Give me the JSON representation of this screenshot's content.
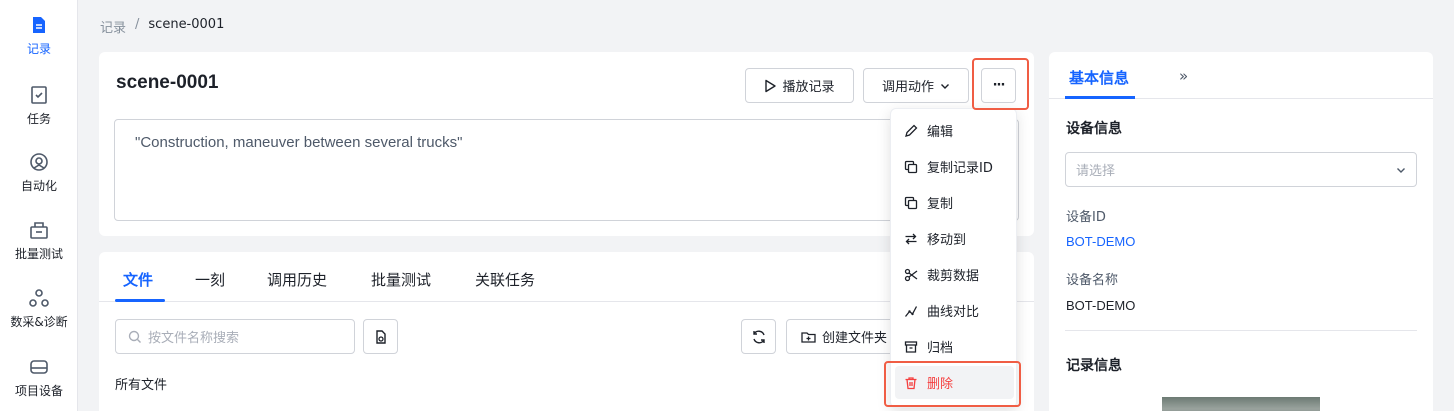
{
  "nav": [
    {
      "label": "记录",
      "icon": "record-icon",
      "active": true
    },
    {
      "label": "任务",
      "icon": "task-icon"
    },
    {
      "label": "自动化",
      "icon": "automation-icon"
    },
    {
      "label": "批量测试",
      "icon": "batch-test-icon"
    },
    {
      "label": "数采&诊断",
      "icon": "data-collection-icon"
    },
    {
      "label": "项目设备",
      "icon": "device-icon"
    }
  ],
  "breadcrumb": {
    "root": "记录",
    "sep": "/",
    "current": "scene-0001"
  },
  "record": {
    "title": "scene-0001",
    "description": "\"Construction, maneuver between several trucks\"",
    "play_label": "播放记录",
    "action_label": "调用动作",
    "more_label": "···"
  },
  "tabs": [
    "文件",
    "一刻",
    "调用历史",
    "批量测试",
    "关联任务"
  ],
  "files": {
    "search_placeholder": "按文件名称搜索",
    "create_folder_label": "创建文件夹",
    "all_files_label": "所有文件"
  },
  "menu": [
    {
      "label": "编辑",
      "icon": "edit-icon"
    },
    {
      "label": "复制记录ID",
      "icon": "copy-id-icon"
    },
    {
      "label": "复制",
      "icon": "copy-icon"
    },
    {
      "label": "移动到",
      "icon": "move-icon"
    },
    {
      "label": "裁剪数据",
      "icon": "scissors-icon"
    },
    {
      "label": "曲线对比",
      "icon": "curve-compare-icon"
    },
    {
      "label": "归档",
      "icon": "archive-icon"
    },
    {
      "label": "删除",
      "icon": "trash-icon",
      "danger": true
    }
  ],
  "side": {
    "tab_label": "基本信息",
    "expand_label": "»",
    "device_section": "设备信息",
    "device_placeholder": "请选择",
    "device_id_label": "设备ID",
    "device_id_value": "BOT-DEMO",
    "device_name_label": "设备名称",
    "device_name_value": "BOT-DEMO",
    "record_section": "记录信息"
  },
  "colors": {
    "accent": "#1664ff",
    "danger": "#f53f3f",
    "highlight": "#f05d44"
  }
}
